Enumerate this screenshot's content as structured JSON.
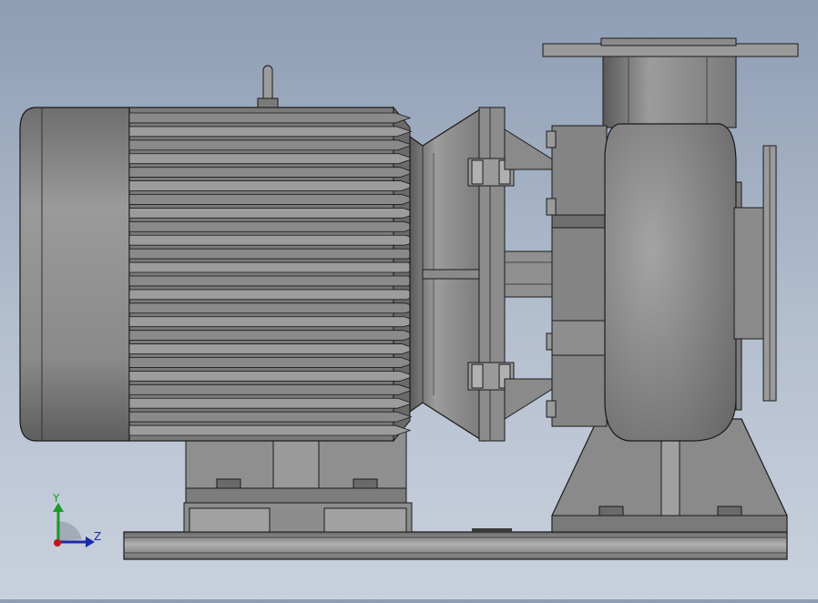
{
  "viewport": {
    "background_top": "#8e9db4",
    "background_bottom": "#c9d1dd"
  },
  "model": {
    "subject": "motor-pump-assembly",
    "parts": [
      "electric-motor",
      "lifting-eye",
      "motor-feet",
      "coupling-bracket",
      "pump-casing",
      "discharge-flange",
      "suction-flange",
      "pump-pedestal",
      "base-rail"
    ],
    "body_color": "#8a8a8a",
    "edge_color": "#1a1a1a"
  },
  "triad": {
    "y_label": "Y",
    "z_label": "Z",
    "y_color": "#1a9a2a",
    "z_color": "#1a2aa8",
    "origin_color": "#c01818"
  }
}
